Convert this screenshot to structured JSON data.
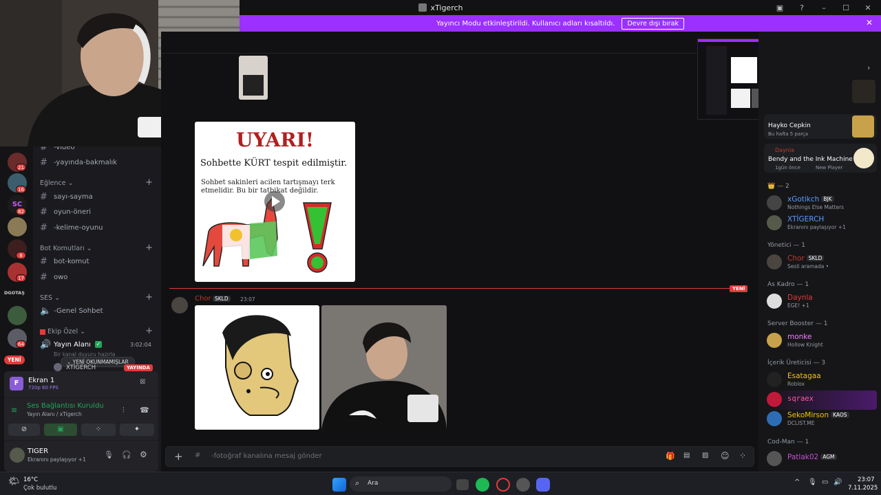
{
  "window": {
    "title": "xTigerch"
  },
  "banner": {
    "message": "Yayıncı Modu etkinleştirildi. Kullanıcı adları kısaltıldı.",
    "button": "Devre dışı bırak"
  },
  "rail": {
    "badges": [
      "21",
      "16",
      "82",
      "8",
      "17",
      "64"
    ],
    "label": "DGOTAŞ",
    "new_label": "YENİ"
  },
  "channels": {
    "items_top": [
      "-video",
      "-yayında-bakmalık"
    ],
    "cat_fun": "Eğlence",
    "fun": [
      "sayı-sayma",
      "oyun-öneri",
      "-kelime-oyunu"
    ],
    "cat_bot": "Bot Komutları",
    "bot": [
      "bot-komut",
      "owo"
    ],
    "cat_ses": "SES",
    "ses": [
      "-Genel Sohbet"
    ],
    "cat_team": "Ekip Özel",
    "stream_room": "Yayın Alanı",
    "stream_time": "3:02:04",
    "stream_sub": "Bir kanal duyuru hazırla",
    "unread_pill": "YENİ OKUNMAMIŞLAR",
    "member_name": "XTİGERCH",
    "live_badge": "YAYINDA"
  },
  "user_panel": {
    "screen_title": "Ekran 1",
    "screen_sub": "720p 60 FPS",
    "voice_status": "Ses Bağlantısı Kuruldu",
    "voice_sub": "Yayın Alanı / xTigerch",
    "username": "TIGER",
    "user_status": "Ekranını paylaşıyor +1"
  },
  "chat": {
    "warning": {
      "title": "UYARI!",
      "line1": "Sohbette KÜRT tespit edilmiştir.",
      "line2": "Sohbet sakinleri acilen tartışmayı terk etmelidir. Bu bir tatbikat değildir."
    },
    "new_divider": "YENİ",
    "msg_author": "Chor",
    "msg_tag": "SKLD",
    "msg_time": "23:07",
    "input_placeholder": "-fotoğraf kanalına mesaj gönder"
  },
  "members": {
    "activity1_title": "Hayko Cepkin",
    "activity1_sub": "Bu hafta 5 parça",
    "activity2_user": "Daynla",
    "activity2_title": "Bendy and the Ink Machine",
    "activity2_sub1": "1gün önce",
    "activity2_sub2": "New Player",
    "group1": "— 2",
    "m1_name": "xGotikch",
    "m1_tag": "BJK",
    "m1_sub": "Nothings Else Matters",
    "m2_name": "XTİGERCH",
    "m2_sub": "Ekranını paylaşıyor +1",
    "group_mod": "Yönetici — 1",
    "m3_name": "Chor",
    "m3_tag": "SKLD",
    "m3_sub": "Sesli aramada •",
    "group_as": "As Kadro — 1",
    "m4_name": "Daynla",
    "m4_sub": "EGE! +1",
    "group_boost": "Server Booster — 1",
    "m5_name": "monke",
    "m5_sub": "Hollow Knight",
    "group_creator": "İçerik Üreticisi — 3",
    "m6_name": "Esatagaa",
    "m6_sub": "Roblox",
    "m7_name": "sqraex",
    "m8_name": "SekoMirson",
    "m8_tag": "KAOS",
    "m8_sub": "DCLIST.ME",
    "group_code": "Cod-Man — 1",
    "m9_name": "Patlak02",
    "m9_tag": "AGM"
  },
  "taskbar": {
    "temp": "16°C",
    "weather": "Çok bulutlu",
    "search": "Ara",
    "time": "23:07",
    "date": "7.11.2025"
  },
  "colors": {
    "accent": "#9b30ff",
    "red": "#e33a3a",
    "green": "#23a55a",
    "blue": "#5b9bff"
  }
}
